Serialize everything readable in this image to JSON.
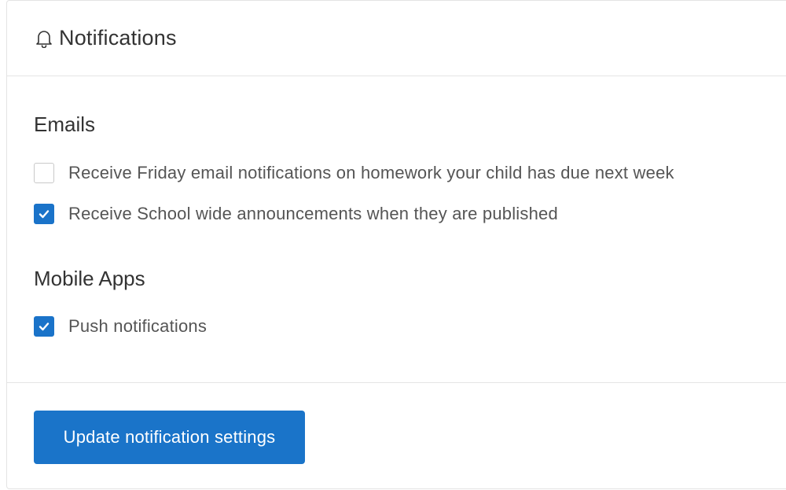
{
  "header": {
    "icon": "bell-icon",
    "title": "Notifications"
  },
  "emails": {
    "title": "Emails",
    "options": [
      {
        "label": "Receive Friday email notifications on homework your child has due next week",
        "checked": false
      },
      {
        "label": "Receive School wide announcements when they are published",
        "checked": true
      }
    ]
  },
  "mobile_apps": {
    "title": "Mobile Apps",
    "options": [
      {
        "label": "Push notifications",
        "checked": true
      }
    ]
  },
  "footer": {
    "update_label": "Update notification settings"
  },
  "colors": {
    "accent": "#1a73c9",
    "border": "#e5e5e5",
    "text": "#333333"
  }
}
